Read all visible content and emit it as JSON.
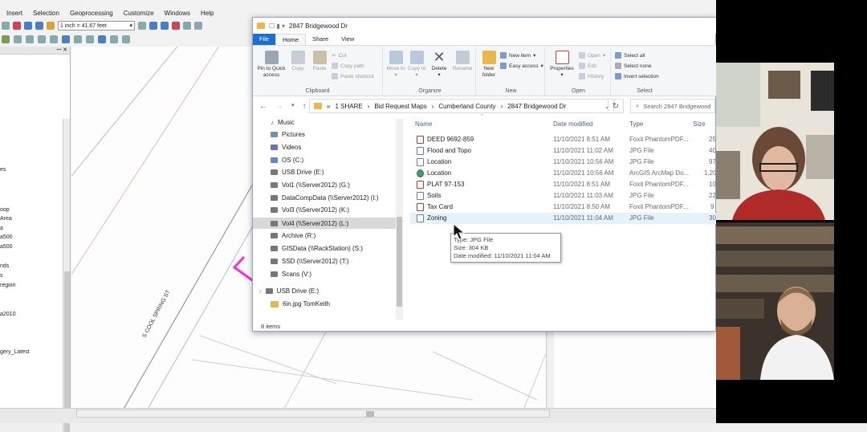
{
  "arcmap": {
    "menu": [
      "Insert",
      "Selection",
      "Geoprocessing",
      "Customize",
      "Windows",
      "Help"
    ],
    "scale": "1 inch = 41.67 feet",
    "toc_items": [
      "es",
      "oop",
      "Area",
      "a",
      "a500",
      "a500",
      "nds",
      "s",
      "region",
      "a2010",
      "gery_Latest"
    ],
    "road_label": "S COOL SPRING ST"
  },
  "explorer": {
    "title": "2847 Bridgewood Dr",
    "tabs": [
      "File",
      "Home",
      "Share",
      "View"
    ],
    "ribbon": {
      "clipboard": {
        "label": "Clipboard",
        "pin": "Pin to Quick access",
        "copy": "Copy",
        "paste": "Paste",
        "cut": "Cut",
        "copy_path": "Copy path",
        "paste_shortcut": "Paste shortcut"
      },
      "organize": {
        "label": "Organize",
        "move_to": "Move to",
        "copy_to": "Copy to",
        "delete": "Delete",
        "rename": "Rename"
      },
      "new": {
        "label": "New",
        "new_folder": "New folder",
        "new_item": "New item",
        "easy_access": "Easy access"
      },
      "open": {
        "label": "Open",
        "properties": "Properties",
        "open": "Open",
        "edit": "Edit",
        "history": "History"
      },
      "select": {
        "label": "Select",
        "select_all": "Select all",
        "select_none": "Select none",
        "invert": "Invert selection"
      }
    },
    "address": [
      "1 SHARE",
      "Bid Request Maps",
      "Cumberland County",
      "2847 Bridgewood Dr"
    ],
    "search_placeholder": "Search 2847 Bridgewood",
    "nav": [
      "Music",
      "Pictures",
      "Videos",
      "OS (C:)",
      "USB Drive (E:)",
      "Vol1 (\\\\Server2012) (G:)",
      "DataCompData (\\\\Server2012) (I:)",
      "Vol3 (\\\\Server2012) (K:)",
      "Vol4 (\\\\Server2012) (L:)",
      "Archive (R:)",
      "GISData (\\\\RackStation) (S:)",
      "SSD (\\\\Server2012) (T:)",
      "Scans (V:)",
      "USB Drive (E:)",
      "6in.jpg TomKeith"
    ],
    "columns": [
      "Name",
      "Date modified",
      "Type",
      "Size"
    ],
    "files": [
      {
        "name": "DEED 9692-859",
        "date": "11/10/2021 8:51 AM",
        "type": "Foxit PhantomPDF...",
        "size": "25"
      },
      {
        "name": "Flood and Topo",
        "date": "11/10/2021 11:02 AM",
        "type": "JPG File",
        "size": "40"
      },
      {
        "name": "Location",
        "date": "11/10/2021 10:56 AM",
        "type": "JPG File",
        "size": "97"
      },
      {
        "name": "Location",
        "date": "11/10/2021 10:56 AM",
        "type": "ArcGIS ArcMap Do...",
        "size": "1,20"
      },
      {
        "name": "PLAT 97-153",
        "date": "11/10/2021 8:51 AM",
        "type": "Foxit PhantomPDF...",
        "size": "10"
      },
      {
        "name": "Soils",
        "date": "11/10/2021 11:03 AM",
        "type": "JPG File",
        "size": "22"
      },
      {
        "name": "Tax Card",
        "date": "11/10/2021 8:50 AM",
        "type": "Foxit PhantomPDF...",
        "size": "9"
      },
      {
        "name": "Zoning",
        "date": "11/10/2021 11:04 AM",
        "type": "JPG File",
        "size": "30"
      }
    ],
    "tooltip": {
      "type": "Type: JPG File",
      "size": "Size: 304 KB",
      "date": "Date modified: 11/10/2021 11:04 AM"
    },
    "item_count": "8 items"
  }
}
